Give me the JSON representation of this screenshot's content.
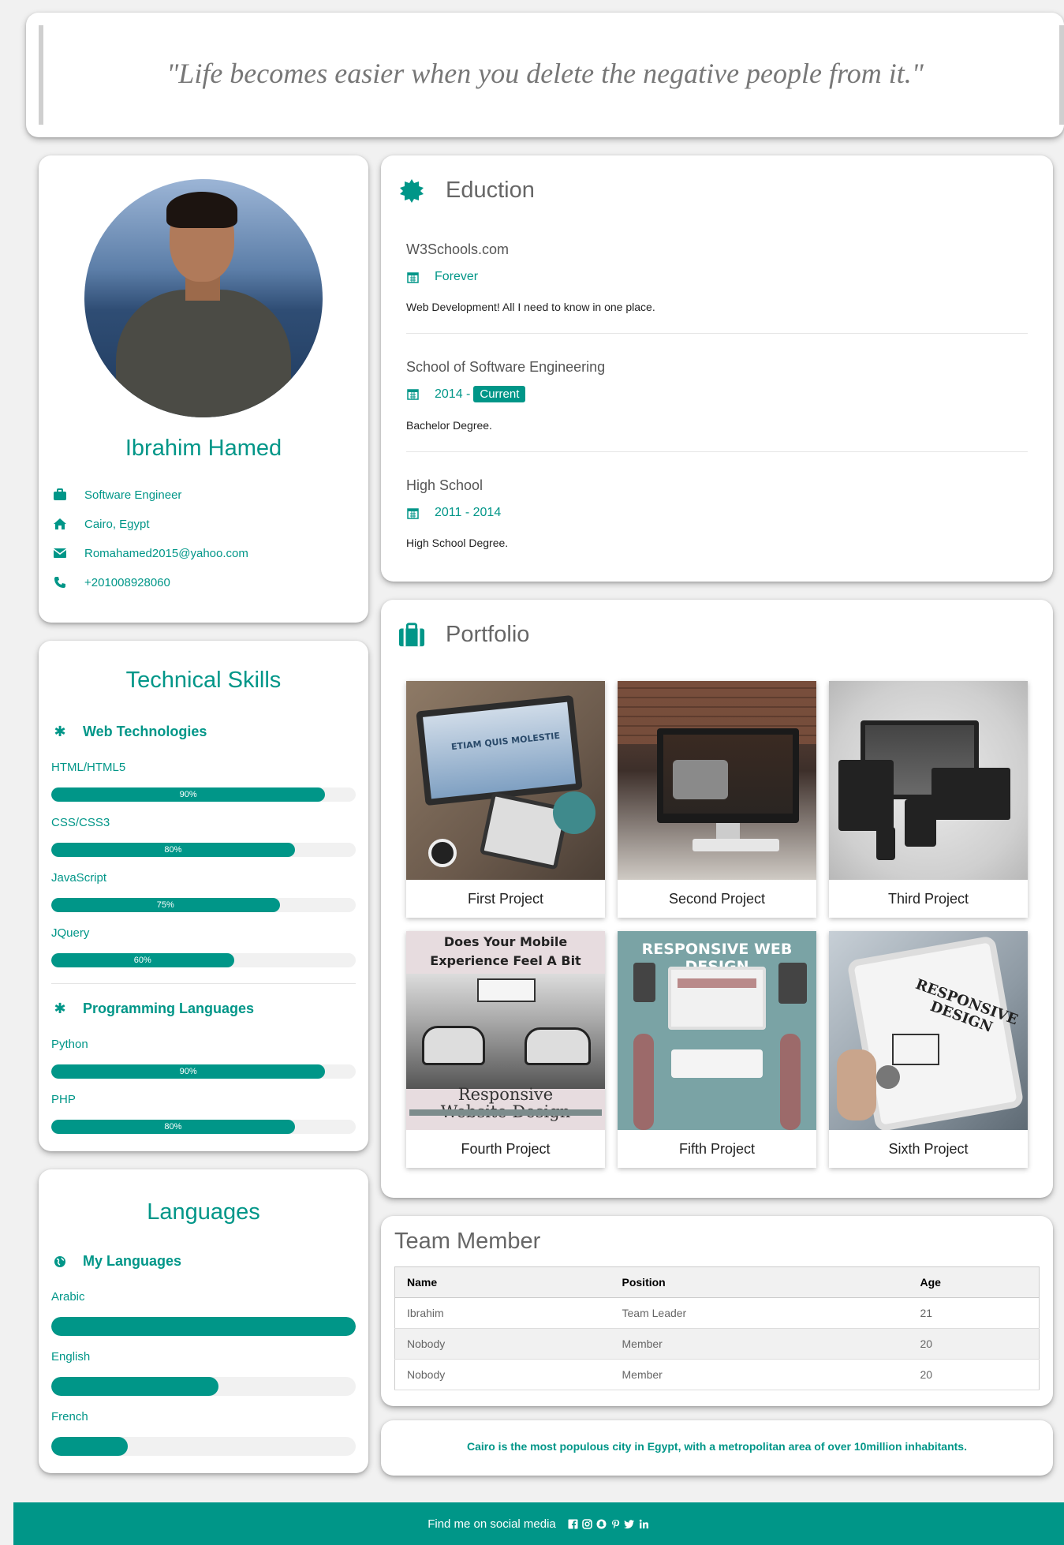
{
  "quote": "\"Life becomes easier when you delete the negative people from it.\"",
  "profile": {
    "name": "Ibrahim Hamed",
    "job": "Software Engineer",
    "location": "Cairo, Egypt",
    "email": "Romahamed2015@yahoo.com",
    "phone": "+201008928060"
  },
  "skills": {
    "title": "Technical Skills",
    "groups": [
      {
        "title": "Web Technologies",
        "items": [
          {
            "label": "HTML/HTML5",
            "percent": 90,
            "text": "90%"
          },
          {
            "label": "CSS/CSS3",
            "percent": 80,
            "text": "80%"
          },
          {
            "label": "JavaScript",
            "percent": 75,
            "text": "75%"
          },
          {
            "label": "JQuery",
            "percent": 60,
            "text": "60%"
          }
        ]
      },
      {
        "title": "Programming Languages",
        "items": [
          {
            "label": "Python",
            "percent": 90,
            "text": "90%"
          },
          {
            "label": "PHP",
            "percent": 80,
            "text": "80%"
          }
        ]
      }
    ]
  },
  "languages": {
    "title": "Languages",
    "group_title": "My Languages",
    "items": [
      {
        "label": "Arabic",
        "percent": 100
      },
      {
        "label": "English",
        "percent": 55
      },
      {
        "label": "French",
        "percent": 25
      }
    ]
  },
  "education": {
    "title": "Eduction",
    "entries": [
      {
        "school": "W3Schools.com",
        "date": "Forever",
        "desc": "Web Development! All I need to know in one place."
      },
      {
        "school": "School of Software Engineering",
        "date": "2014 -",
        "tag": "Current",
        "desc": "Bachelor Degree."
      },
      {
        "school": "High School",
        "date": "2011 - 2014",
        "desc": "High School Degree."
      }
    ]
  },
  "portfolio": {
    "title": "Portfolio",
    "projects": [
      {
        "name": "First Project",
        "image_text": "ETIAM QUIS MOLESTIE"
      },
      {
        "name": "Second Project"
      },
      {
        "name": "Third Project"
      },
      {
        "name": "Fourth Project",
        "image_text_top": "Does Your Mobile Experience Feel A Bit Behind the Times?",
        "image_text_bottom": "Responsive Website Design"
      },
      {
        "name": "Fifth Project",
        "image_text": "RESPONSIVE WEB DESIGN"
      },
      {
        "name": "Sixth Project",
        "image_text": "RESPONSIVE DESIGN"
      }
    ]
  },
  "team": {
    "title": "Team Member",
    "columns": [
      "Name",
      "Position",
      "Age"
    ],
    "rows": [
      [
        "Ibrahim",
        "Team Leader",
        "21"
      ],
      [
        "Nobody",
        "Member",
        "20"
      ],
      [
        "Nobody",
        "Member",
        "20"
      ]
    ]
  },
  "info": "Cairo is the most populous city in Egypt, with a metropolitan area of over 10million inhabitants.",
  "footer": {
    "text": "Find me on social media",
    "icons": [
      "facebook-icon",
      "instagram-icon",
      "snapchat-icon",
      "pinterest-icon",
      "twitter-icon",
      "linkedin-icon"
    ]
  },
  "colors": {
    "accent": "#009688",
    "background": "#f1f1f1"
  }
}
